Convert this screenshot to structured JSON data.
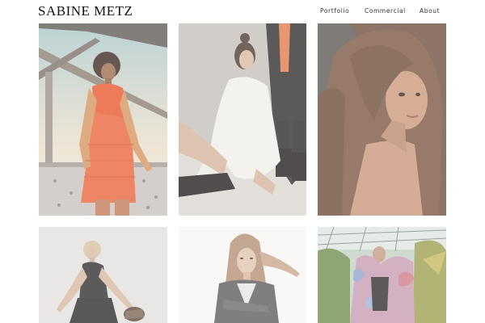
{
  "header": {
    "site_title": "SABINE METZ",
    "nav": {
      "portfolio": "Portfolio",
      "commercial": "Commercial",
      "about": "About"
    }
  },
  "gallery": {
    "photos": [
      {
        "icon": "photo-woman-orange-dress-bridge"
      },
      {
        "icon": "photo-woman-white-jacket-seated"
      },
      {
        "icon": "photo-woman-long-hair-portrait"
      },
      {
        "icon": "photo-woman-dark-dress-holding-object"
      },
      {
        "icon": "photo-woman-grey-blazer"
      },
      {
        "icon": "photo-woman-feather-coat-greenhouse"
      }
    ]
  },
  "colors": {
    "background": "#ffffff",
    "title": "#111111",
    "nav_text": "#333333"
  }
}
